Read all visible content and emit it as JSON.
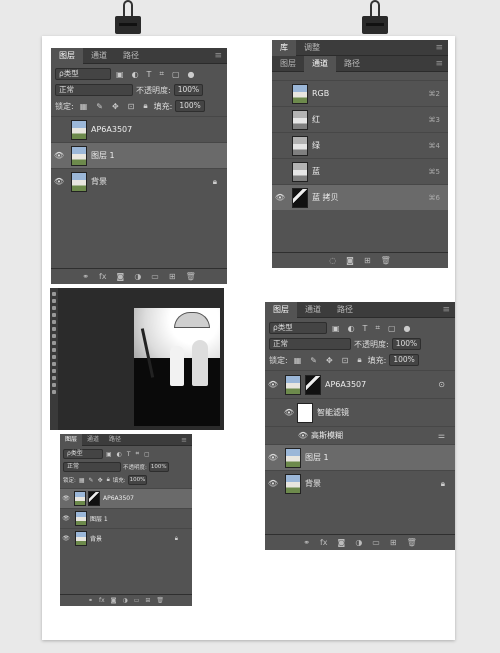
{
  "layers_panel": {
    "tabs": [
      "图层",
      "通道",
      "路径"
    ],
    "filter_label": "ρ类型",
    "blend_mode": "正常",
    "opacity_label": "不透明度:",
    "opacity_value": "100%",
    "lock_label": "锁定:",
    "fill_label": "填充:",
    "fill_value": "100%",
    "layers": [
      {
        "name": "AP6A3507",
        "visible": false
      },
      {
        "name": "图层 1",
        "visible": true
      },
      {
        "name": "背景",
        "visible": true
      }
    ],
    "footer_fx": "fx"
  },
  "channels_panel": {
    "top_tabs": [
      "库",
      "调整"
    ],
    "tabs": [
      "图层",
      "通道",
      "路径"
    ],
    "channels": [
      {
        "name": "RGB",
        "shortcut": "⌘2"
      },
      {
        "name": "红",
        "shortcut": "⌘3"
      },
      {
        "name": "绿",
        "shortcut": "⌘4"
      },
      {
        "name": "蓝",
        "shortcut": "⌘5"
      },
      {
        "name": "蓝 拷贝",
        "shortcut": "⌘6"
      }
    ]
  },
  "layers_panel_2": {
    "tabs": [
      "图层",
      "通道",
      "路径"
    ],
    "filter_label": "ρ类型",
    "blend_mode": "正常",
    "opacity_label": "不透明度:",
    "opacity_value": "100%",
    "lock_label": "锁定:",
    "fill_label": "填充:",
    "fill_value": "100%",
    "smart_layer": "AP6A3507",
    "smart_filters": "智能滤镜",
    "filter_name": "高斯模糊",
    "layer1": "图层 1",
    "background": "背景",
    "footer_fx": "fx"
  },
  "layers_panel_small": {
    "tabs": [
      "图层",
      "通道",
      "路径"
    ],
    "filter_label": "ρ类型",
    "blend_mode": "正常",
    "opacity_label": "不透明度:",
    "opacity_value": "100%",
    "lock_label": "锁定:",
    "fill_label": "填充:",
    "fill_value": "100%",
    "layers": [
      "AP6A3507",
      "图层 1",
      "背景"
    ],
    "footer_fx": "fx"
  }
}
